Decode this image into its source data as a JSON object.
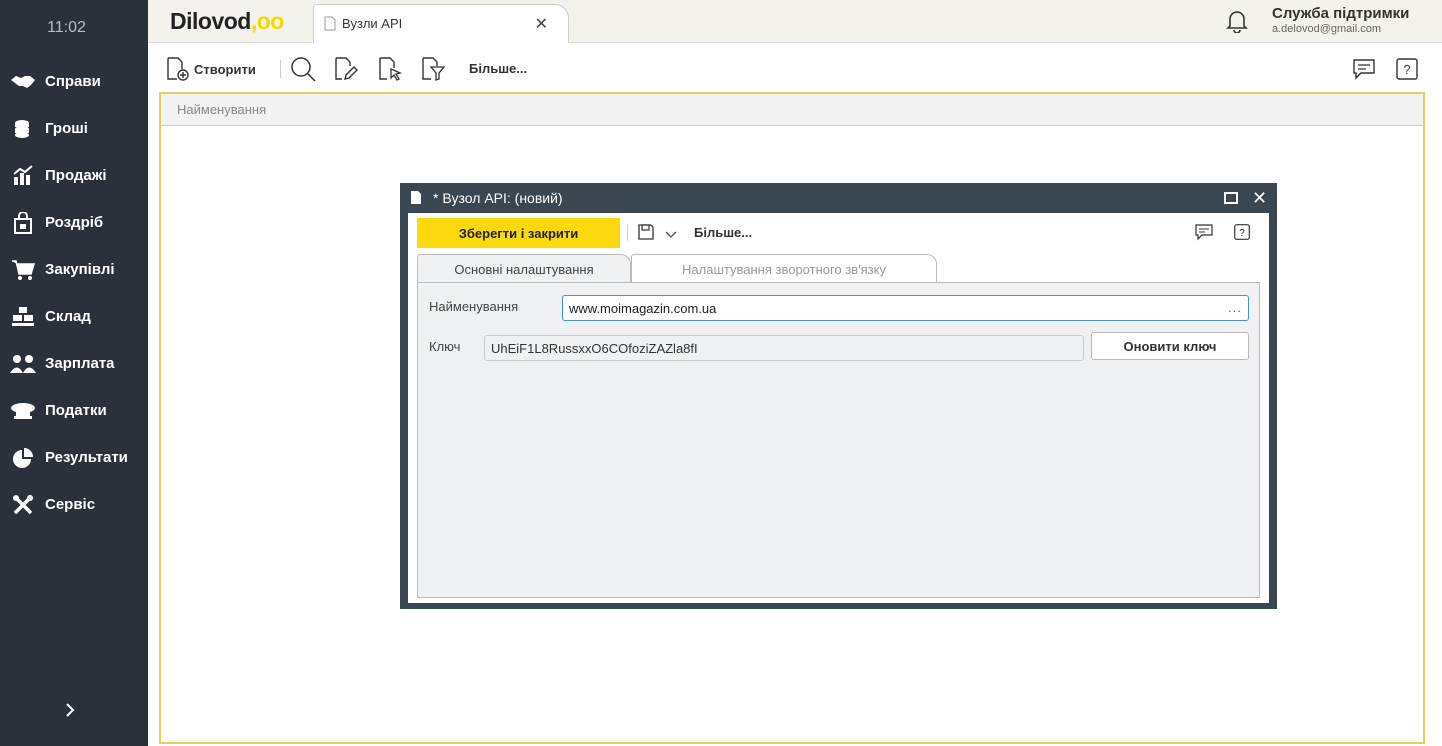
{
  "sidebar": {
    "clock": "11:02",
    "items": [
      {
        "label": "Справи",
        "icon": "handshake-icon"
      },
      {
        "label": "Гроші",
        "icon": "coins-icon"
      },
      {
        "label": "Продажі",
        "icon": "chart-icon"
      },
      {
        "label": "Роздріб",
        "icon": "shopping-bag-icon"
      },
      {
        "label": "Закупівлі",
        "icon": "cart-icon"
      },
      {
        "label": "Склад",
        "icon": "boxes-icon"
      },
      {
        "label": "Зарплата",
        "icon": "people-icon"
      },
      {
        "label": "Податки",
        "icon": "cap-icon"
      },
      {
        "label": "Результати",
        "icon": "pie-chart-icon"
      },
      {
        "label": "Сервіс",
        "icon": "tools-icon"
      }
    ]
  },
  "header": {
    "logo_text": "Dilovod",
    "logo_suffix": ",oo",
    "tab_label": "Вузли API",
    "tab_close": "✕",
    "support_name": "Служба підтримки",
    "support_email": "a.delovod@gmail.com"
  },
  "toolbar": {
    "create_label": "Створити",
    "more_label": "Більше..."
  },
  "list": {
    "column_header": "Найменування"
  },
  "dialog": {
    "title": "* Вузол API: (новий)",
    "close_glyph": "✕",
    "save_close_label": "Зберегти і закрити",
    "more_label": "Більше...",
    "tabs": [
      {
        "label": "Основні налаштування",
        "active": true
      },
      {
        "label": "Налаштування зворотного зв'язку",
        "active": false
      }
    ],
    "name_label": "Найменування",
    "name_value": "www.moimagazin.com.ua",
    "name_dots": "...",
    "key_label": "Ключ",
    "key_value": "UhEiF1L8RussxxO6COfoziZAZla8fI",
    "refresh_key_label": "Оновити ключ"
  },
  "colors": {
    "sidebar_bg": "#2b313b",
    "accent_yellow": "#fcd90c",
    "dialog_frame": "#3a4651"
  }
}
